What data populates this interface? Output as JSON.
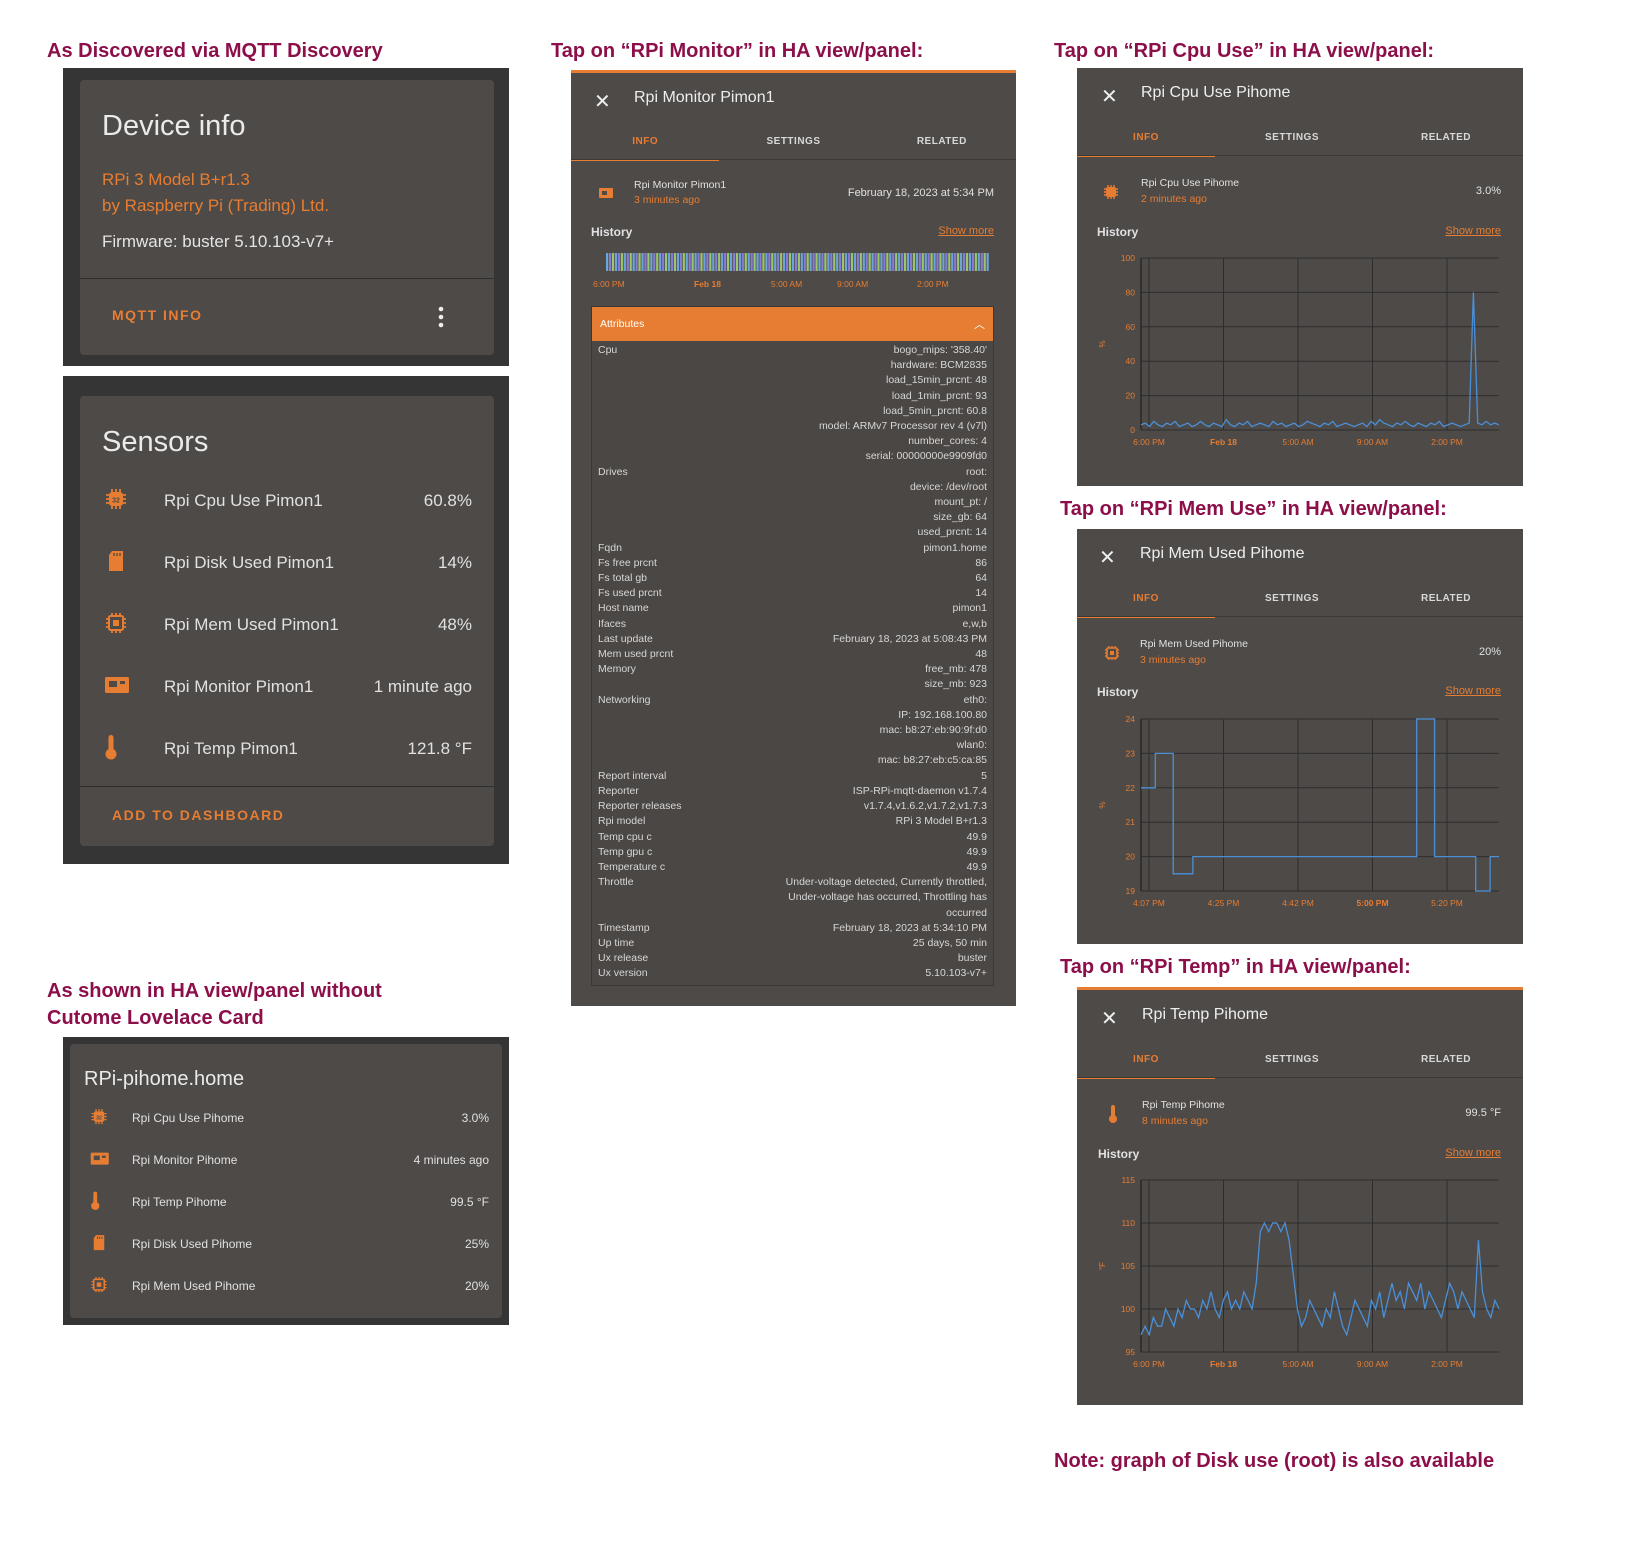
{
  "captions": {
    "mqtt": "As Discovered via MQTT Discovery",
    "monitor": "Tap on “RPi Monitor” in HA view/panel:",
    "cpu": "Tap on “RPi Cpu Use” in HA view/panel:",
    "mem": "Tap on “RPi Mem Use” in HA view/panel:",
    "temp": "Tap on “RPi Temp” in HA view/panel:",
    "nocard_1": "As shown in HA view/panel without",
    "nocard_2": "Cutome Lovelace Card",
    "note": "Note: graph of Disk use (root) is also available"
  },
  "device": {
    "title": "Device info",
    "model": "RPi 3 Model B+r1.3",
    "maker": "by Raspberry Pi (Trading) Ltd.",
    "firmware": "Firmware: buster 5.10.103-v7+",
    "mqtt_info": "MQTT INFO"
  },
  "sensors": {
    "title": "Sensors",
    "add": "ADD TO DASHBOARD",
    "items": [
      {
        "name": "Rpi Cpu Use Pimon1",
        "value": "60.8%",
        "icon": "cpu-icon"
      },
      {
        "name": "Rpi Disk Used Pimon1",
        "value": "14%",
        "icon": "sd-card-icon"
      },
      {
        "name": "Rpi Mem Used Pimon1",
        "value": "48%",
        "icon": "memory-chip-icon"
      },
      {
        "name": "Rpi Monitor Pimon1",
        "value": "1 minute ago",
        "icon": "raspberry-board-icon"
      },
      {
        "name": "Rpi Temp Pimon1",
        "value": "121.8 °F",
        "icon": "thermometer-icon"
      }
    ]
  },
  "pihome": {
    "title": "RPi-pihome.home",
    "items": [
      {
        "name": "Rpi Cpu Use Pihome",
        "value": "3.0%"
      },
      {
        "name": "Rpi Monitor Pihome",
        "value": "4 minutes ago"
      },
      {
        "name": "Rpi Temp Pihome",
        "value": "99.5 °F"
      },
      {
        "name": "Rpi Disk Used Pihome",
        "value": "25%"
      },
      {
        "name": "Rpi Mem Used Pihome",
        "value": "20%"
      }
    ]
  },
  "tabs": {
    "info": "INFO",
    "settings": "SETTINGS",
    "related": "RELATED"
  },
  "history": "History",
  "show_more": "Show more",
  "monitor": {
    "title": "Rpi Monitor Pimon1",
    "entity": "Rpi Monitor Pimon1",
    "ago": "3 minutes ago",
    "state": "February 18, 2023 at 5:34 PM",
    "ticks": [
      "6:00 PM",
      "Feb 18",
      "5:00 AM",
      "9:00 AM",
      "2:00 PM"
    ],
    "attributes_label": "Attributes",
    "attributes": [
      {
        "k": "Cpu",
        "v": [
          "bogo_mips: '358.40'",
          "hardware: BCM2835",
          "load_15min_prcnt: 48",
          "load_1min_prcnt: 93",
          "load_5min_prcnt: 60.8",
          "model: ARMv7 Processor rev 4 (v7l)",
          "number_cores: 4",
          "serial: 00000000e9909fd0"
        ]
      },
      {
        "k": "Drives",
        "v": [
          "root:",
          "device: /dev/root",
          "mount_pt: /",
          "size_gb: 64",
          "used_prcnt: 14"
        ]
      },
      {
        "k": "Fqdn",
        "v": [
          "pimon1.home"
        ]
      },
      {
        "k": "Fs free prcnt",
        "v": [
          "86"
        ]
      },
      {
        "k": "Fs total gb",
        "v": [
          "64"
        ]
      },
      {
        "k": "Fs used prcnt",
        "v": [
          "14"
        ]
      },
      {
        "k": "Host name",
        "v": [
          "pimon1"
        ]
      },
      {
        "k": "Ifaces",
        "v": [
          "e,w,b"
        ]
      },
      {
        "k": "Last update",
        "v": [
          "February 18, 2023 at 5:08:43 PM"
        ]
      },
      {
        "k": "Mem used prcnt",
        "v": [
          "48"
        ]
      },
      {
        "k": "Memory",
        "v": [
          "free_mb: 478",
          "size_mb: 923"
        ]
      },
      {
        "k": "Networking",
        "v": [
          "eth0:",
          "IP: 192.168.100.80",
          "mac: b8:27:eb:90:9f:d0",
          "wlan0:",
          "mac: b8:27:eb:c5:ca:85"
        ]
      },
      {
        "k": "Report interval",
        "v": [
          "5"
        ]
      },
      {
        "k": "Reporter",
        "v": [
          "ISP-RPi-mqtt-daemon v1.7.4"
        ]
      },
      {
        "k": "Reporter releases",
        "v": [
          "v1.7.4,v1.6.2,v1.7.2,v1.7.3"
        ]
      },
      {
        "k": "Rpi model",
        "v": [
          "RPi 3 Model B+r1.3"
        ]
      },
      {
        "k": "Temp cpu c",
        "v": [
          "49.9"
        ]
      },
      {
        "k": "Temp gpu c",
        "v": [
          "49.9"
        ]
      },
      {
        "k": "Temperature c",
        "v": [
          "49.9"
        ]
      },
      {
        "k": "Throttle",
        "v": [
          "Under-voltage detected, Currently throttled,",
          "Under-voltage has occurred, Throttling has",
          "occurred"
        ]
      },
      {
        "k": "Timestamp",
        "v": [
          "February 18, 2023 at 5:34:10 PM"
        ]
      },
      {
        "k": "Up time",
        "v": [
          "25 days, 50 min"
        ]
      },
      {
        "k": "Ux release",
        "v": [
          "buster"
        ]
      },
      {
        "k": "Ux version",
        "v": [
          "5.10.103-v7+"
        ]
      }
    ]
  },
  "cpu": {
    "title": "Rpi Cpu Use Pihome",
    "entity": "Rpi Cpu Use Pihome",
    "ago": "2 minutes ago",
    "state": "3.0%"
  },
  "mem": {
    "title": "Rpi Mem Used Pihome",
    "entity": "Rpi Mem Used Pihome",
    "ago": "3 minutes ago",
    "state": "20%"
  },
  "temp": {
    "title": "Rpi Temp Pihome",
    "entity": "Rpi Temp Pihome",
    "ago": "8 minutes ago",
    "state": "99.5 °F"
  },
  "chart_data": [
    {
      "type": "line",
      "name": "cpu",
      "ylabel": "%",
      "ylim": [
        0,
        100
      ],
      "yticks": [
        0,
        20,
        40,
        60,
        80,
        100
      ],
      "xticks": [
        "6:00 PM",
        "Feb 18",
        "5:00 AM",
        "9:00 AM",
        "2:00 PM"
      ],
      "values": [
        3,
        4,
        2,
        5,
        3,
        2,
        4,
        3,
        5,
        2,
        3,
        4,
        2,
        3,
        5,
        3,
        2,
        4,
        3,
        2,
        6,
        3,
        2,
        4,
        3,
        5,
        2,
        3,
        4,
        3,
        2,
        5,
        3,
        4,
        2,
        3,
        4,
        2,
        3,
        5,
        4,
        3,
        2,
        4,
        3,
        5,
        2,
        3,
        4,
        3,
        2,
        3,
        4,
        2,
        5,
        3,
        6,
        4,
        3,
        2,
        4,
        3,
        5,
        3,
        2,
        4,
        3,
        2,
        4,
        3,
        5,
        2,
        3,
        4,
        3,
        2,
        3,
        4,
        80,
        4,
        3,
        5,
        3,
        4,
        3
      ]
    },
    {
      "type": "line",
      "name": "mem",
      "ylabel": "%",
      "ylim": [
        19,
        24
      ],
      "yticks": [
        19,
        20,
        21,
        22,
        23,
        24
      ],
      "xticks": [
        "4:07 PM",
        "4:25 PM",
        "4:42 PM",
        "5:00 PM",
        "5:20 PM"
      ],
      "x": [
        0,
        0.04,
        0.04,
        0.09,
        0.09,
        0.145,
        0.145,
        0.77,
        0.77,
        0.82,
        0.82,
        0.935,
        0.935,
        0.975,
        0.975,
        1
      ],
      "values": [
        22,
        22,
        23,
        23,
        19.5,
        19.5,
        20,
        20,
        24,
        24,
        20,
        20,
        19,
        19,
        20,
        20
      ]
    },
    {
      "type": "line",
      "name": "temp",
      "ylabel": "°F",
      "ylim": [
        95,
        115
      ],
      "yticks": [
        95,
        100,
        105,
        110,
        115
      ],
      "xticks": [
        "6:00 PM",
        "Feb 18",
        "5:00 AM",
        "9:00 AM",
        "2:00 PM"
      ],
      "values": [
        97,
        98,
        97,
        99,
        98,
        98,
        100,
        99,
        98,
        100,
        99,
        101,
        100,
        100,
        99,
        101,
        100,
        102,
        100,
        99,
        101,
        102,
        100,
        101,
        100,
        102,
        101,
        100,
        103,
        109,
        110,
        109,
        110,
        110,
        109,
        110,
        108,
        104,
        100,
        98,
        99,
        101,
        100,
        99,
        98,
        100,
        99,
        102,
        100,
        98,
        97,
        99,
        101,
        100,
        99,
        98,
        101,
        100,
        102,
        99,
        101,
        103,
        101,
        102,
        100,
        103,
        102,
        101,
        103,
        100,
        102,
        101,
        100,
        99,
        101,
        103,
        102,
        100,
        102,
        101,
        100,
        99,
        108,
        102,
        100,
        99,
        101,
        100
      ]
    }
  ]
}
